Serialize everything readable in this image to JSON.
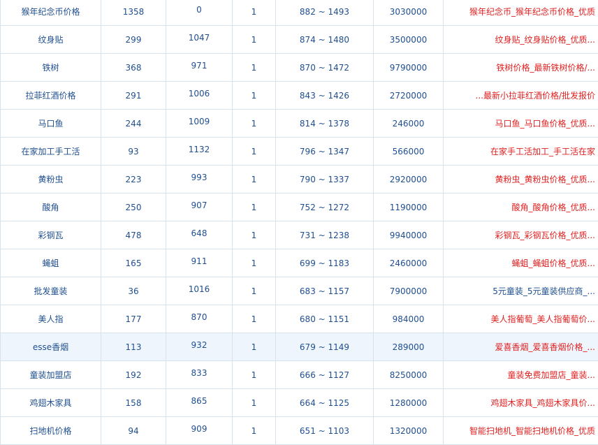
{
  "table": {
    "rows": [
      {
        "keyword": "猴年纪念币价格",
        "a": "1358",
        "b": "0",
        "c": "1",
        "range": "882 ~ 1493",
        "d": "3030000",
        "title": "猴年纪念币_猴年纪念币价格_优质",
        "title_color": "mixed"
      },
      {
        "keyword": "纹身贴",
        "a": "299",
        "b": "1047",
        "c": "1",
        "range": "874 ~ 1480",
        "d": "3500000",
        "title": "纹身贴_纹身贴价格_优质...",
        "title_color": "red"
      },
      {
        "keyword": "铁树",
        "a": "368",
        "b": "971",
        "c": "1",
        "range": "870 ~ 1472",
        "d": "9790000",
        "title": "铁树价格_最新铁树价格/...",
        "title_color": "red"
      },
      {
        "keyword": "拉菲红酒价格",
        "a": "291",
        "b": "1006",
        "c": "1",
        "range": "843 ~ 1426",
        "d": "2720000",
        "title": "...最新小拉菲红酒价格/批发报价",
        "title_color": "mixed"
      },
      {
        "keyword": "马口鱼",
        "a": "244",
        "b": "1009",
        "c": "1",
        "range": "814 ~ 1378",
        "d": "246000",
        "title": "马口鱼_马口鱼价格_优质...",
        "title_color": "red"
      },
      {
        "keyword": "在家加工手工活",
        "a": "93",
        "b": "1132",
        "c": "1",
        "range": "796 ~ 1347",
        "d": "566000",
        "title": "在家手工活加工_手工活在家",
        "title_color": "red"
      },
      {
        "keyword": "黄粉虫",
        "a": "223",
        "b": "993",
        "c": "1",
        "range": "790 ~ 1337",
        "d": "2920000",
        "title": "黄粉虫_黄粉虫价格_优质...",
        "title_color": "red"
      },
      {
        "keyword": "酸角",
        "a": "250",
        "b": "907",
        "c": "1",
        "range": "752 ~ 1272",
        "d": "1190000",
        "title": "酸角_酸角价格_优质...",
        "title_color": "red"
      },
      {
        "keyword": "彩钢瓦",
        "a": "478",
        "b": "648",
        "c": "1",
        "range": "731 ~ 1238",
        "d": "9940000",
        "title": "彩钢瓦_彩钢瓦价格_优质...",
        "title_color": "red"
      },
      {
        "keyword": "蝇蛆",
        "a": "165",
        "b": "911",
        "c": "1",
        "range": "699 ~ 1183",
        "d": "2460000",
        "title": "蝇蛆_蝇蛆价格_优质...",
        "title_color": "red"
      },
      {
        "keyword": "批发童装",
        "a": "36",
        "b": "1016",
        "c": "1",
        "range": "683 ~ 1157",
        "d": "7900000",
        "title": "5元童装_5元童装供应商_...",
        "title_color": "blue"
      },
      {
        "keyword": "美人指",
        "a": "177",
        "b": "870",
        "c": "1",
        "range": "680 ~ 1151",
        "d": "984000",
        "title": "美人指葡萄_美人指葡萄价...",
        "title_color": "red"
      },
      {
        "keyword": "esse香烟",
        "a": "113",
        "b": "932",
        "c": "1",
        "range": "679 ~ 1149",
        "d": "289000",
        "title": "爱喜香烟_爱喜香烟价格_...",
        "title_color": "red",
        "highlight": true
      },
      {
        "keyword": "童装加盟店",
        "a": "192",
        "b": "833",
        "c": "1",
        "range": "666 ~ 1127",
        "d": "8250000",
        "title": "童装免费加盟店_童装...",
        "title_color": "red"
      },
      {
        "keyword": "鸡翅木家具",
        "a": "158",
        "b": "865",
        "c": "1",
        "range": "664 ~ 1125",
        "d": "1280000",
        "title": "鸡翅木家具_鸡翅木家具价...",
        "title_color": "red"
      },
      {
        "keyword": "扫地机价格",
        "a": "94",
        "b": "909",
        "c": "1",
        "range": "651 ~ 1103",
        "d": "1320000",
        "title": "智能扫地机_智能扫地机价格_优质",
        "title_color": "mixed"
      }
    ]
  }
}
